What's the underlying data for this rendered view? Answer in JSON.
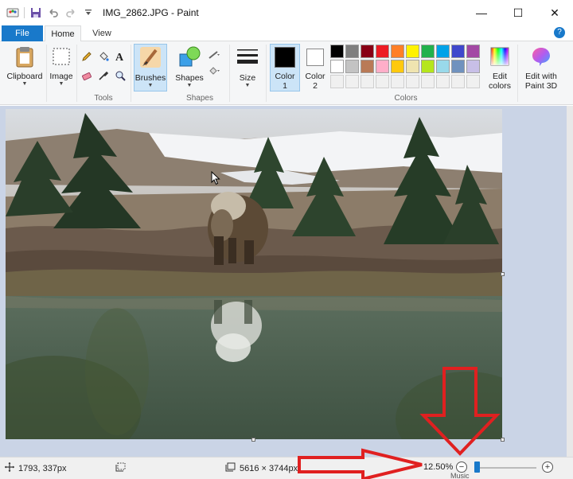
{
  "window": {
    "title": "IMG_2862.JPG - Paint",
    "minimize": "—",
    "maximize": "☐",
    "close": "✕"
  },
  "tabs": [
    {
      "label": "File"
    },
    {
      "label": "Home"
    },
    {
      "label": "View"
    }
  ],
  "help": "?",
  "ribbon": {
    "clipboard": "Clipboard",
    "image": "Image",
    "tools": "Tools",
    "brushes": "Brushes",
    "shapes": "Shapes",
    "shapes_group": "Shapes",
    "size": "Size",
    "color1": "Color\n1",
    "color1_line1": "Color",
    "color1_line2": "1",
    "color2_line1": "Color",
    "color2_line2": "2",
    "colors_group": "Colors",
    "edit_colors_line1": "Edit",
    "edit_colors_line2": "colors",
    "edit_paint3d_line1": "Edit with",
    "edit_paint3d_line2": "Paint 3D"
  },
  "palette": {
    "row1": [
      "#000000",
      "#7f7f7f",
      "#880015",
      "#ed1c24",
      "#ff7f27",
      "#fff200",
      "#22b14c",
      "#00a2e8",
      "#3f48cc",
      "#a349a4"
    ],
    "row2": [
      "#ffffff",
      "#c3c3c3",
      "#b97a57",
      "#ffaec9",
      "#ffc90e",
      "#efe4b0",
      "#b5e61d",
      "#99d9ea",
      "#7092be",
      "#c8bfe7"
    ],
    "selected_color1": "#000000",
    "selected_color2": "#ffffff"
  },
  "status": {
    "cursor_pos": "1793, 337px",
    "image_size": "5616 × 3744px",
    "zoom": "12.50%",
    "zoom_level": 0.0,
    "taskbar_fragment": "Music"
  },
  "annotation": {
    "arrow_color": "#e02020"
  }
}
